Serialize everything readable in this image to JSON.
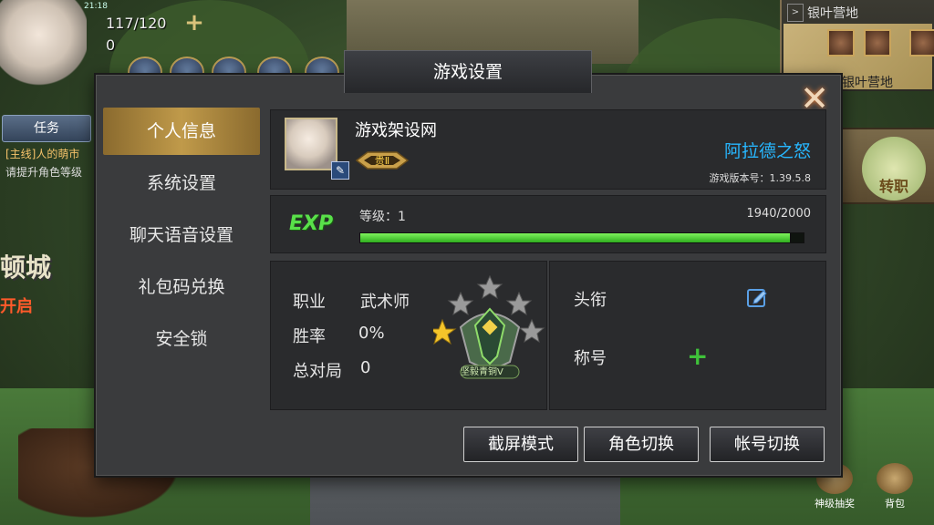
{
  "hud": {
    "time": "21:18",
    "stamina": "117/120",
    "currency": "0",
    "add_label": "+",
    "task_button": "任务",
    "quest_line1": "[主线]人的萌市",
    "quest_line2": "请提升角色等级",
    "left_city": "顿城",
    "left_open": "开启"
  },
  "minimap": {
    "toggle": ">",
    "title": "银叶营地",
    "label": "银叶营地"
  },
  "right_side": {
    "turn_label": "转职"
  },
  "bottom_buttons": [
    {
      "label": "神级抽奖"
    },
    {
      "label": "背包"
    }
  ],
  "dialog": {
    "title": "游戏设置",
    "close_symbol": "✕",
    "menu": [
      {
        "label": "个人信息",
        "active": true
      },
      {
        "label": "系统设置",
        "active": false
      },
      {
        "label": "聊天语音设置",
        "active": false
      },
      {
        "label": "礼包码兑换",
        "active": false
      },
      {
        "label": "安全锁",
        "active": false
      }
    ],
    "profile": {
      "name": "游戏架设网",
      "server": "阿拉德之怒",
      "version": "游戏版本号：1.39.5.8",
      "vip_label": "贵Ⅱ",
      "edit_symbol": "✎"
    },
    "exp": {
      "logo": "EXP",
      "level_label": "等级：1",
      "value_text": "1940/2000",
      "current": 1940,
      "max": 2000
    },
    "stats": {
      "job_label": "职业",
      "job_value": "武术师",
      "winrate_label": "胜率",
      "winrate_value": "0%",
      "matches_label": "总对局",
      "matches_value": "0",
      "rank_name": "坚毅青铜V"
    },
    "titles": {
      "headtitle_label": "头衔",
      "nickname_label": "称号",
      "add_symbol": "+"
    },
    "buttons": {
      "screenshot": "截屏模式",
      "switch_role": "角色切换",
      "switch_account": "帐号切换"
    }
  },
  "colors": {
    "accent_gold": "#c09a4a",
    "server_blue": "#27b7ff",
    "exp_green": "#59e04a"
  }
}
